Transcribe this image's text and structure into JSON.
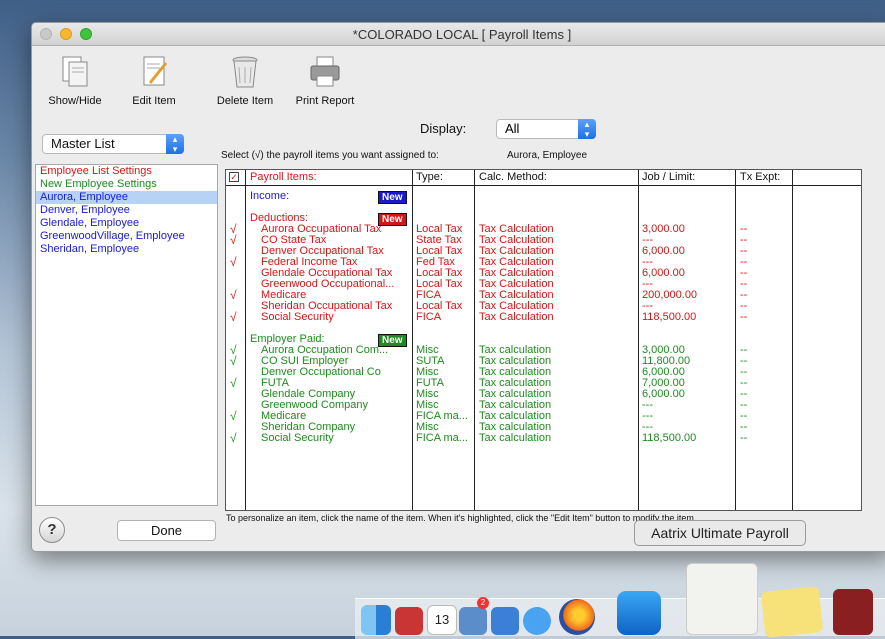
{
  "window": {
    "title": "*COLORADO LOCAL [ Payroll Items ]"
  },
  "toolbar": {
    "show_hide": "Show/Hide",
    "edit_item": "Edit Item",
    "delete_item": "Delete Item",
    "print_report": "Print Report"
  },
  "left": {
    "selector": "Master List",
    "items": [
      {
        "label": "Employee List Settings"
      },
      {
        "label": "New Employee Settings"
      },
      {
        "label": "Aurora, Employee"
      },
      {
        "label": "Denver, Employee"
      },
      {
        "label": "Glendale, Employee"
      },
      {
        "label": "GreenwoodVillage, Employee"
      },
      {
        "label": "Sheridan, Employee"
      }
    ]
  },
  "display": {
    "label": "Display:",
    "value": "All"
  },
  "instructions": "Select (√) the payroll items you want assigned to:",
  "assigned_to": "Aurora, Employee",
  "grid": {
    "headers": {
      "items": "Payroll Items:",
      "type": "Type:",
      "calc": "Calc. Method:",
      "job": "Job / Limit:",
      "tx": "Tx Expt:"
    },
    "new_badge": "New",
    "income_label": "Income:",
    "deductions_label": "Deductions:",
    "employer_label": "Employer Paid:",
    "deductions": [
      {
        "check": "√",
        "name": "Aurora Occupational Tax",
        "type": "Local Tax",
        "calc": "Tax Calculation",
        "job": "3,000.00",
        "tx": "--"
      },
      {
        "check": "√",
        "name": "CO State Tax",
        "type": "State Tax",
        "calc": "Tax Calculation",
        "job": "---",
        "tx": "--"
      },
      {
        "check": "",
        "name": "Denver Occupational Tax",
        "type": "Local Tax",
        "calc": "Tax Calculation",
        "job": "6,000.00",
        "tx": "--"
      },
      {
        "check": "√",
        "name": "Federal Income Tax",
        "type": "Fed Tax",
        "calc": "Tax Calculation",
        "job": "---",
        "tx": "--"
      },
      {
        "check": "",
        "name": "Glendale Occupational Tax",
        "type": "Local Tax",
        "calc": "Tax Calculation",
        "job": "6,000.00",
        "tx": "--"
      },
      {
        "check": "",
        "name": "Greenwood Occupational...",
        "type": "Local Tax",
        "calc": "Tax Calculation",
        "job": "---",
        "tx": "--"
      },
      {
        "check": "√",
        "name": "Medicare",
        "type": "FICA",
        "calc": "Tax Calculation",
        "job": "200,000.00",
        "tx": "--"
      },
      {
        "check": "",
        "name": "Sheridan Occupational Tax",
        "type": "Local Tax",
        "calc": "Tax Calculation",
        "job": "---",
        "tx": "--"
      },
      {
        "check": "√",
        "name": "Social Security",
        "type": "FICA",
        "calc": "Tax Calculation",
        "job": "118,500.00",
        "tx": "--"
      }
    ],
    "employer": [
      {
        "check": "√",
        "name": "Aurora Occupation Com...",
        "type": "Misc",
        "calc": "Tax calculation",
        "job": "3,000.00",
        "tx": "--"
      },
      {
        "check": "√",
        "name": "CO SUI Employer",
        "type": "SUTA",
        "calc": "Tax calculation",
        "job": "11,800.00",
        "tx": "--"
      },
      {
        "check": "",
        "name": "Denver Occupational Co",
        "type": "Misc",
        "calc": "Tax calculation",
        "job": "6,000.00",
        "tx": "--"
      },
      {
        "check": "√",
        "name": "FUTA",
        "type": "FUTA",
        "calc": "Tax calculation",
        "job": "7,000.00",
        "tx": "--"
      },
      {
        "check": "",
        "name": "Glendale Company",
        "type": "Misc",
        "calc": "Tax calculation",
        "job": "6,000.00",
        "tx": "--"
      },
      {
        "check": "",
        "name": "Greenwood Company",
        "type": "Misc",
        "calc": "Tax calculation",
        "job": "---",
        "tx": "--"
      },
      {
        "check": "√",
        "name": "Medicare",
        "type": "FICA ma...",
        "calc": "Tax calculation",
        "job": "---",
        "tx": "--"
      },
      {
        "check": "",
        "name": "Sheridan Company",
        "type": "Misc",
        "calc": "Tax calculation",
        "job": "---",
        "tx": "--"
      },
      {
        "check": "√",
        "name": "Social Security",
        "type": "FICA ma...",
        "calc": "Tax calculation",
        "job": "118,500.00",
        "tx": "--"
      }
    ]
  },
  "footnote": "To personalize an item, click the name of the item.  When it's highlighted, click the \"Edit Item\" button to modify the item.",
  "help_label": "?",
  "done_label": "Done",
  "tooltip": "Aatrix Ultimate Payroll",
  "dock": {
    "calendar_day": "13",
    "badge_count": "2"
  }
}
